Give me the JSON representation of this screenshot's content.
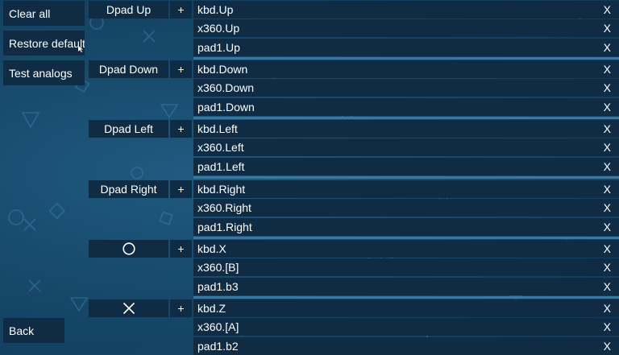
{
  "sidebar": {
    "clear_all": "Clear all",
    "restore_defaults": "Restore defaults",
    "test_analogs": "Test analogs",
    "back": "Back"
  },
  "add_label": "+",
  "delete_label": "X",
  "groups": [
    {
      "name": "Dpad Up",
      "icon": null,
      "bindings": [
        "kbd.Up",
        "x360.Up",
        "pad1.Up"
      ]
    },
    {
      "name": "Dpad Down",
      "icon": null,
      "bindings": [
        "kbd.Down",
        "x360.Down",
        "pad1.Down"
      ]
    },
    {
      "name": "Dpad Left",
      "icon": null,
      "bindings": [
        "kbd.Left",
        "x360.Left",
        "pad1.Left"
      ]
    },
    {
      "name": "Dpad Right",
      "icon": null,
      "bindings": [
        "kbd.Right",
        "x360.Right",
        "pad1.Right"
      ]
    },
    {
      "name": "",
      "icon": "circle-icon",
      "bindings": [
        "kbd.X",
        "x360.[B]",
        "pad1.b3"
      ]
    },
    {
      "name": "",
      "icon": "cross-icon",
      "bindings": [
        "kbd.Z",
        "x360.[A]",
        "pad1.b2"
      ]
    }
  ]
}
